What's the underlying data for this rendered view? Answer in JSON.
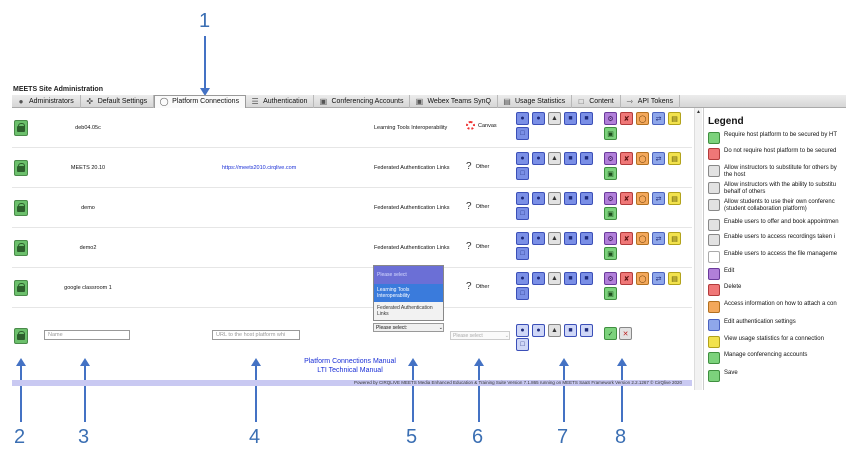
{
  "callouts": [
    "1",
    "2",
    "3",
    "4",
    "5",
    "6",
    "7",
    "8"
  ],
  "app_title": "MEETS Site Administration",
  "tabs": [
    {
      "label": "Administrators",
      "icon": "user-icon"
    },
    {
      "label": "Default Settings",
      "icon": "wrench-icon"
    },
    {
      "label": "Platform Connections",
      "icon": "link-icon",
      "active": true
    },
    {
      "label": "Authentication",
      "icon": "sliders-icon"
    },
    {
      "label": "Conferencing Accounts",
      "icon": "monitor-icon"
    },
    {
      "label": "Webex Teams SynQ",
      "icon": "monitor-icon"
    },
    {
      "label": "Usage Statistics",
      "icon": "chart-icon"
    },
    {
      "label": "Content",
      "icon": "document-icon"
    },
    {
      "label": "API Tokens",
      "icon": "key-icon"
    }
  ],
  "rows": [
    {
      "name": "deb04.05c",
      "url": "",
      "auth": "Learning Tools Interoperability",
      "host": "Canvas",
      "host_icon": "canvas-icon"
    },
    {
      "name": "MEETS 20.10",
      "url": "https://meets2010.cirqlive.com",
      "auth": "Federated Authentication Links",
      "host": "Other",
      "host_icon": "question-icon"
    },
    {
      "name": "demo",
      "url": "",
      "auth": "Federated Authentication Links",
      "host": "Other",
      "host_icon": "question-icon"
    },
    {
      "name": "demo2",
      "url": "",
      "auth": "Federated Authentication Links",
      "host": "Other",
      "host_icon": "question-icon"
    },
    {
      "name": "google classroom 1",
      "url": "",
      "auth": "",
      "host": "Other",
      "host_icon": "question-icon"
    }
  ],
  "new_row": {
    "name_placeholder": "Name",
    "url_placeholder": "URL to the host platform whi",
    "auth_select": "Please select:",
    "host_select": "Please select"
  },
  "dropdown_options": [
    "Please select",
    "Learning Tools Interoperability",
    "Federated Authentication Links"
  ],
  "manual_links": [
    "Platform Connections Manual",
    "LTI Technical Manual"
  ],
  "footer": "Powered by CIRQLIVE MEETS Media Enhanced Education & Training Suite Version 7.1.865 running on MEETS SaaS Framework Version 2.2.1267 © CirQlive 2020",
  "legend": {
    "title": "Legend",
    "items": [
      {
        "text": "Require host platform to be secured by HT",
        "color": "green",
        "icon": "lock-icon"
      },
      {
        "text": "Do not require host platform to be secured",
        "color": "red",
        "icon": "unlock-icon"
      },
      {
        "text": "Allow instructors to substitute for others by",
        "text2": "the host",
        "color": "grey",
        "icon": "substitute-icon"
      },
      {
        "text": "Allow instructors with the ability to substitu",
        "text2": "behalf of others",
        "color": "grey",
        "icon": "substitute-others-icon"
      },
      {
        "text": "Allow students to use their own conferenc",
        "text2": "(student collaboration platform)",
        "color": "grey",
        "icon": "student-icon"
      },
      {
        "text": "Enable users to offer and book appointmen",
        "color": "grey",
        "icon": "appointment-icon"
      },
      {
        "text": "Enable users to access recordings taken i",
        "color": "grey",
        "icon": "recording-icon"
      },
      {
        "text": "Enable users to access the file manageme",
        "color": "plain",
        "icon": "file-icon"
      },
      {
        "text": "Edit",
        "color": "purple",
        "icon": "gear-icon"
      },
      {
        "text": "Delete",
        "color": "red",
        "icon": "delete-icon"
      },
      {
        "text": "Access information on how to attach a con",
        "color": "orange",
        "icon": "link-icon"
      },
      {
        "text": "Edit authentication settings",
        "color": "lblue",
        "icon": "auth-settings-icon"
      },
      {
        "text": "View usage statistics for a connection",
        "color": "yellow",
        "icon": "stats-icon"
      },
      {
        "text": "Manage conferencing accounts",
        "color": "green",
        "icon": "accounts-icon"
      },
      {
        "text": "Save",
        "color": "green",
        "icon": "save-icon"
      }
    ]
  }
}
